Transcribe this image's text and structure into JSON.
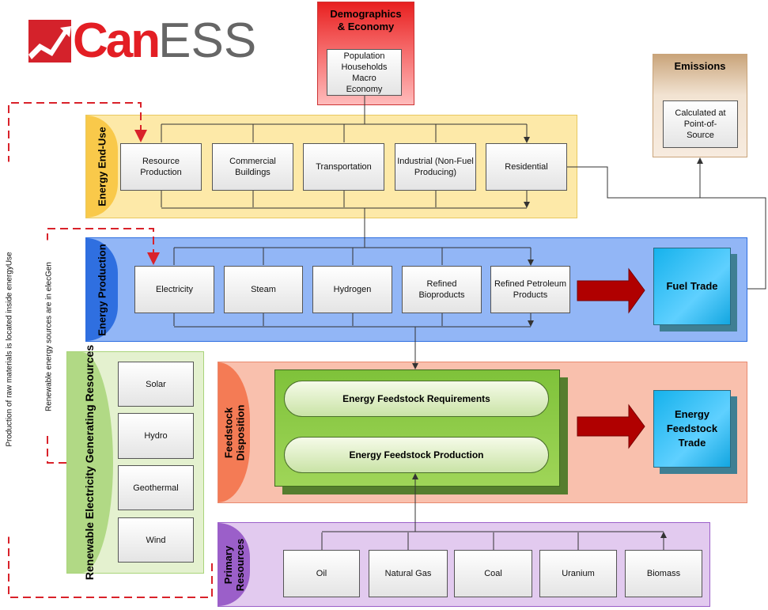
{
  "logo": {
    "text_can": "Can",
    "text_ess": "ESS"
  },
  "demographics": {
    "title": "Demographics & Economy",
    "items": "Population Households Macro Economy"
  },
  "emissions": {
    "title": "Emissions",
    "items": "Calculated at Point-of-Source"
  },
  "end_use": {
    "label": "Energy End-Use",
    "items": [
      "Resource Production",
      "Commercial Buildings",
      "Transportation",
      "Industrial (Non-Fuel Producing)",
      "Residential"
    ]
  },
  "production": {
    "label": "Energy Production",
    "items": [
      "Electricity",
      "Steam",
      "Hydrogen",
      "Refined Bioproducts",
      "Refined Petroleum Products"
    ],
    "trade": "Fuel Trade"
  },
  "renewable": {
    "label": "Renewable Electricity Generating Resources",
    "items": [
      "Solar",
      "Hydro",
      "Geothermal",
      "Wind"
    ]
  },
  "feedstock": {
    "label": "Feedstock Disposition",
    "requirements": "Energy Feedstock Requirements",
    "production": "Energy Feedstock Production",
    "trade": "Energy Feedstock Trade"
  },
  "primary": {
    "label": "Primary Resources",
    "items": [
      "Oil",
      "Natural Gas",
      "Coal",
      "Uranium",
      "Biomass"
    ]
  },
  "notes": {
    "outer": "Production of raw materials is located inside energyUse",
    "inner": "Renewable energy sources are in elecGen"
  },
  "colors": {
    "accent_red": "#e31e24",
    "dashed": "#d9222a",
    "arrow": "#b00000"
  }
}
